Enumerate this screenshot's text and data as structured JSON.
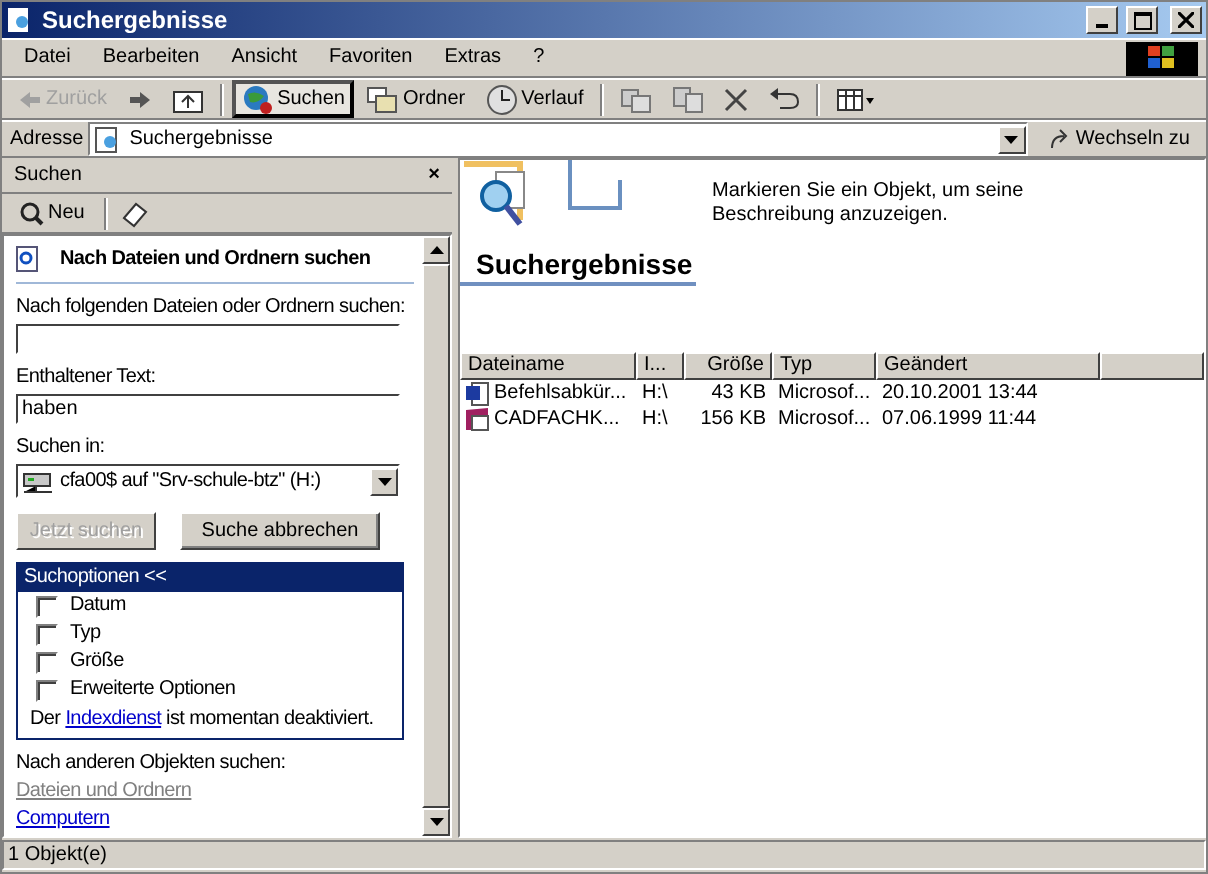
{
  "window": {
    "title": "Suchergebnisse"
  },
  "menu": [
    "Datei",
    "Bearbeiten",
    "Ansicht",
    "Favoriten",
    "Extras",
    "?"
  ],
  "toolbar": [
    {
      "kind": "back",
      "label": "Zurück",
      "disabled": true,
      "selected": false
    },
    {
      "kind": "forward",
      "selected": false
    },
    {
      "kind": "up",
      "selected": false
    },
    {
      "kind": "search",
      "label": "Suchen",
      "disabled": false,
      "selected": true
    },
    {
      "kind": "folders",
      "label": "Ordner",
      "disabled": false,
      "selected": false
    },
    {
      "kind": "history",
      "label": "Verlauf",
      "disabled": false,
      "selected": false
    },
    {
      "kind": "move",
      "selected": false
    },
    {
      "kind": "copy",
      "selected": false
    },
    {
      "kind": "delete",
      "selected": false
    },
    {
      "kind": "undo",
      "selected": false
    },
    {
      "kind": "views",
      "selected": false
    }
  ],
  "address": {
    "label": "Adresse",
    "value": "Suchergebnisse",
    "go": "Wechseln zu"
  },
  "search_pane": {
    "title": "Suchen",
    "close": "×",
    "new_label": "Neu",
    "heading": "Nach Dateien und Ordnern suchen",
    "fields": [
      {
        "label": "Nach folgenden Dateien oder Ordnern suchen:"
      },
      {
        "label": "Enthaltener Text:",
        "value": "haben"
      }
    ],
    "search_in": {
      "label": "Suchen in:",
      "value": "cfa00$ auf \"Srv-schule-btz\" (H:)"
    },
    "buttons": [
      {
        "label": "Jetzt suchen",
        "disabled": true
      },
      {
        "label": "Suche abbrechen",
        "disabled": false
      }
    ],
    "options": {
      "title": "Suchoptionen <<",
      "items": [
        {
          "label": "Datum",
          "checked": false
        },
        {
          "label": "Typ",
          "checked": false
        },
        {
          "label": "Größe",
          "checked": false
        },
        {
          "label": "Erweiterte Optionen",
          "checked": false
        }
      ],
      "note_before": "Der",
      "note_link": "Indexdienst",
      "note_after": "ist momentan deaktiviert."
    },
    "other": {
      "title": "Nach anderen Objekten suchen:",
      "links": [
        {
          "label": "Dateien und Ordnern",
          "disabled": true
        },
        {
          "label": "Computern",
          "disabled": false
        }
      ]
    }
  },
  "results": {
    "banner_title": "Suchergebnisse",
    "description": "Markieren Sie ein Objekt, um seine Beschreibung anzuzeigen.",
    "columns": [
      "Dateiname",
      "I...",
      "Größe",
      "Typ",
      "Geändert"
    ],
    "rows": [
      {
        "kind": "word",
        "cells": [
          "Befehlsabkür...",
          "H:\\",
          "43 KB",
          "Microsof...",
          "20.10.2001 13:44"
        ]
      },
      {
        "kind": "access",
        "cells": [
          "CADFACHK...",
          "H:\\",
          "156 KB",
          "Microsof...",
          "07.06.1999 11:44"
        ]
      }
    ]
  },
  "status_bar": "1 Objekt(e)"
}
